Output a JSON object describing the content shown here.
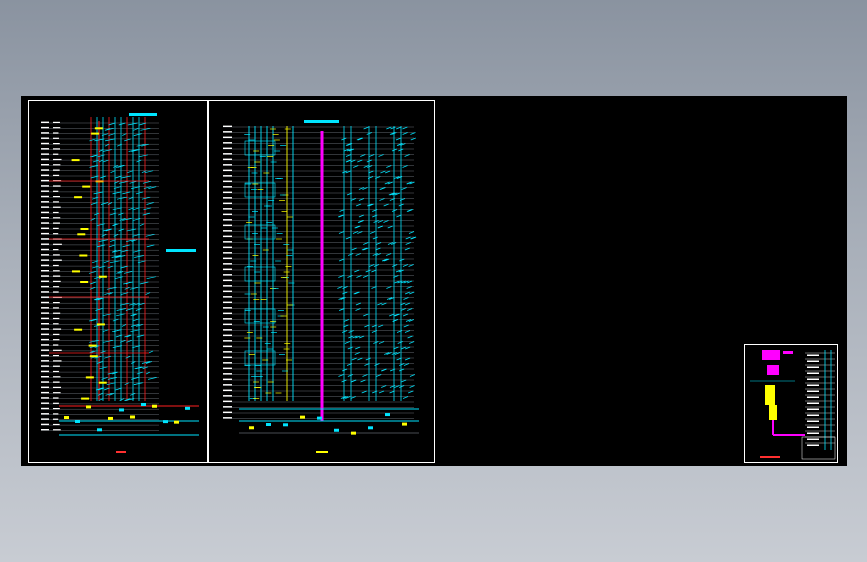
{
  "drawing": {
    "background": "#000000",
    "sheet_border_color": "#ffffff",
    "sheets": [
      {
        "name": "riser-diagram-left",
        "palette": {
          "lines": "#00e5ff",
          "mains": "#ff2020",
          "labels": "#ffffff",
          "accent": "#ffff00"
        }
      },
      {
        "name": "riser-diagram-middle",
        "palette": {
          "lines": "#00e5ff",
          "main_riser": "#ff00ff",
          "labels": "#ffffff",
          "accent": "#ffff00"
        }
      },
      {
        "name": "detail-sheet-right",
        "palette": {
          "lines": "#00e5ff",
          "highlight": "#ff00ff",
          "tank": "#ffff00",
          "labels": "#ffffff"
        }
      }
    ]
  }
}
